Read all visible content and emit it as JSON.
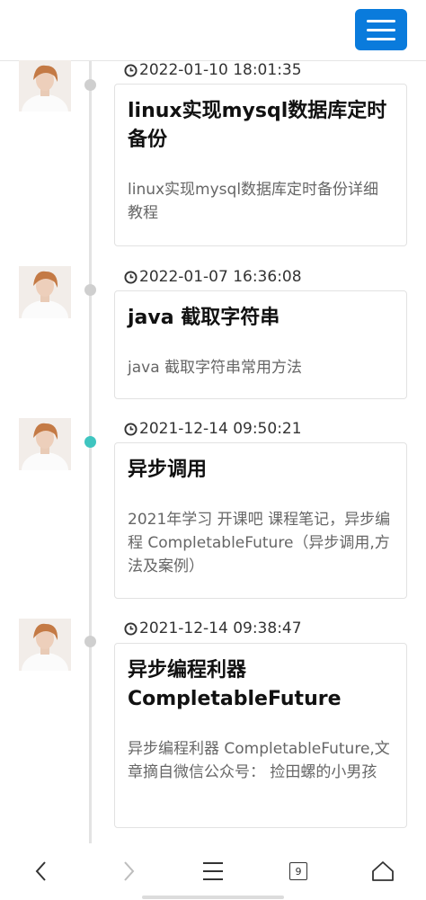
{
  "header": {
    "menu_icon": "hamburger-menu-icon"
  },
  "posts": [
    {
      "time": "2022-01-10 18:01:35",
      "title": "linux实现mysql数据库定时备份",
      "desc": "linux实现mysql数据库定时备份详细教程",
      "active": false
    },
    {
      "time": "2022-01-07 16:36:08",
      "title": "java 截取字符串",
      "desc": "java 截取字符串常用方法",
      "active": false
    },
    {
      "time": "2021-12-14 09:50:21",
      "title": "异步调用",
      "desc": "2021年学习 开课吧 课程笔记，异步编程 CompletableFuture（异步调用,方法及案例）",
      "active": true
    },
    {
      "time": "2021-12-14 09:38:47",
      "title": "异步编程利器CompletableFuture",
      "desc": "异步编程利器 CompletableFuture,文章摘自微信公众号： 捡田螺的小男孩",
      "active": false
    }
  ],
  "colors": {
    "accent": "#0a7bdc",
    "active_dot": "#3fc5c0",
    "dot": "#cfcfcf"
  },
  "bottom_nav": {
    "icons": [
      "back-arrow-icon",
      "forward-arrow-icon",
      "menu-lines-icon",
      "tabs-icon",
      "home-icon"
    ],
    "tab_count": "9"
  }
}
